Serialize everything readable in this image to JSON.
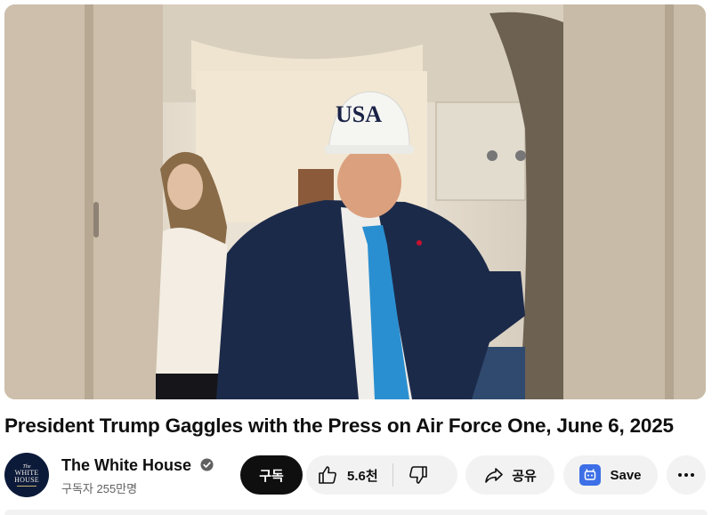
{
  "video": {
    "cap_text": "USA"
  },
  "title": "President Trump Gaggles with the Press on Air Force One, June 6, 2025",
  "channel": {
    "name": "The White House",
    "subscribers": "구독자 255만명",
    "avatar_lines": [
      "The",
      "WHITE",
      "HOUSE"
    ]
  },
  "actions": {
    "subscribe_label": "구독",
    "like_count": "5.6천",
    "share_label": "공유",
    "save_label": "Save"
  },
  "icons": {
    "verified": "verified-check-icon",
    "like": "thumbs-up-icon",
    "dislike": "thumbs-down-icon",
    "share": "share-arrow-icon",
    "save": "save-bookmark-icon",
    "more": "more-horizontal-icon"
  },
  "colors": {
    "subscribe_bg": "#0f0f0f",
    "pill_bg": "#f2f2f2",
    "save_icon": "#3d6fe6",
    "tie": "#2a8fd0",
    "suit": "#1c2a4a"
  }
}
